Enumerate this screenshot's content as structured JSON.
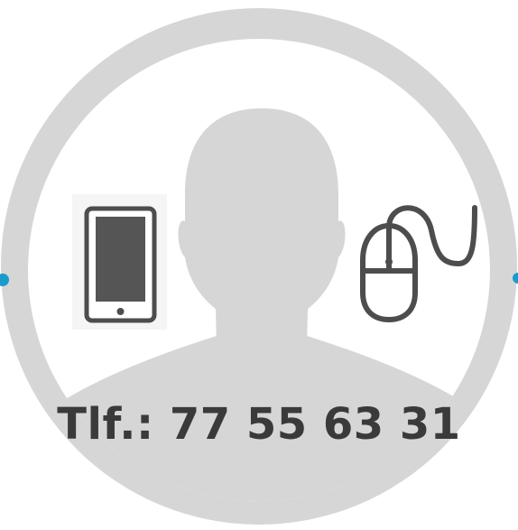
{
  "contact": {
    "phone_text": "Tlf.: 77 55 63 31"
  },
  "icons": {
    "avatar": "person-silhouette-icon",
    "phone": "smartphone-icon",
    "mouse": "computer-mouse-icon"
  },
  "colors": {
    "circle": "#d6d6d6",
    "silhouette": "#d6d6d6",
    "background": "#ffffff",
    "icon_stroke": "#4d4d4d",
    "phone_screen": "#555555",
    "text": "#3a3a3a",
    "accent_dot": "#1a9bcc"
  }
}
